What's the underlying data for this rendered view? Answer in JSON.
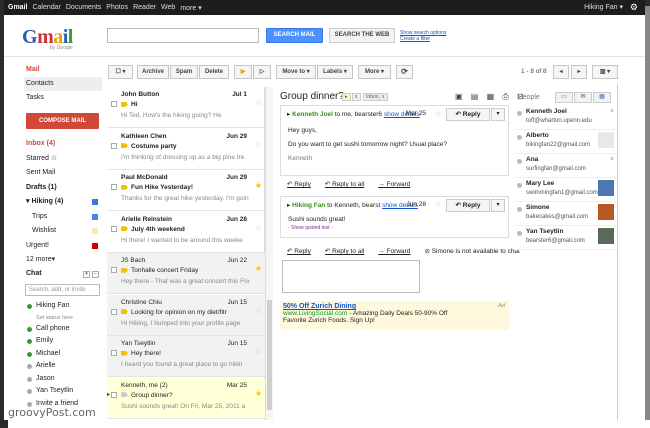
{
  "topbar": {
    "links": [
      "Gmail",
      "Calendar",
      "Documents",
      "Photos",
      "Reader",
      "Web",
      "more ▾"
    ],
    "user": "Hiking Fan ▾"
  },
  "logo": {
    "g": "G",
    "m": "m",
    "a": "a",
    "i": "i",
    "l": "l",
    "sub": "by Google"
  },
  "search": {
    "placeholder": "",
    "mail_button": "SEARCH MAIL",
    "web_button": "SEARCH THE WEB",
    "options_link": "Show search options",
    "filter_link": "Create a filter"
  },
  "nav": {
    "mail": "Mail",
    "contacts": "Contacts",
    "tasks": "Tasks",
    "compose": "COMPOSE MAIL",
    "folders": [
      {
        "label": "Inbox (4)",
        "style": "red"
      },
      {
        "label": "Starred ☆",
        "style": ""
      },
      {
        "label": "Sent Mail",
        "style": ""
      },
      {
        "label": "Drafts (1)",
        "style": "bold"
      },
      {
        "label": "▾ Hiking (4)",
        "style": "bold",
        "swatch": "#3c78d8"
      },
      {
        "label": "Trips",
        "style": "indent",
        "swatch": "#4a86e8"
      },
      {
        "label": "Wishlist",
        "style": "indent",
        "swatch": "#fce8b3"
      },
      {
        "label": "Urgent!",
        "style": "",
        "swatch": "#cc0000"
      },
      {
        "label": "12 more▾",
        "style": ""
      }
    ]
  },
  "chat": {
    "title": "Chat",
    "search_placeholder": "Search, add, or invite",
    "me": "Hiking Fan",
    "status": "Set status here",
    "contacts": [
      {
        "name": "Call phone",
        "color": "#3a9a3a"
      },
      {
        "name": "Emily",
        "color": "#3a9a3a"
      },
      {
        "name": "Michael",
        "color": "#3a9a3a"
      },
      {
        "name": "Arielle",
        "color": "#aaaaaa"
      },
      {
        "name": "Jason",
        "color": "#aaaaaa"
      },
      {
        "name": "Yan Tseytlin",
        "color": "#aaaaaa"
      },
      {
        "name": "Invite a friend",
        "color": "#aaaaaa"
      }
    ]
  },
  "toolbar": {
    "select": "☐ ▾",
    "archive": "Archive",
    "spam": "Spam",
    "delete": "Delete",
    "important": "▶",
    "not_important": "▷",
    "move": "Move to ▾",
    "labels": "Labels ▾",
    "more": "More ▾",
    "refresh": "⟳",
    "pager": "1 - 8 of 8",
    "prev": "◂",
    "next": "▸",
    "view": "▥ ▾"
  },
  "messages": [
    {
      "from": "John Button",
      "date": "Jul 1",
      "subject": "Hi",
      "snippet": "Hi Ted, How's the hiking going? He",
      "unread": true,
      "starred": false,
      "important": true
    },
    {
      "from": "Kathleen Chen",
      "date": "Jun 29",
      "subject": "Costume party",
      "snippet": "I'm thinking of dressing up as a big pine tre",
      "unread": true,
      "starred": false,
      "important": true
    },
    {
      "from": "Paul McDonald",
      "date": "Jun 29",
      "subject": "Fun Hike Yesterday!",
      "snippet": "Thanks for the great hike yesterday. I'm goin",
      "unread": true,
      "starred": true,
      "important": true
    },
    {
      "from": "Arielle Reinstein",
      "date": "Jun 28",
      "subject": "July 4th weekend",
      "snippet": "Hi there! I wanted to be around this weeke",
      "unread": true,
      "starred": false,
      "important": true
    },
    {
      "from": "JS Bach",
      "date": "Jun 22",
      "subject": "Tonhalle concert Friday",
      "snippet": "Hey there - That was a great concert this Frida",
      "unread": false,
      "starred": true,
      "important": true
    },
    {
      "from": "Christine Chiu",
      "date": "Jun 15",
      "subject": "Hi Hiking, I bumped into your profile page",
      "snippet": "",
      "unread": false,
      "starred": false,
      "important": true,
      "subject_prefix": "Looking for opinion on my diet/fitr"
    },
    {
      "from": "Yan Tseytlin",
      "date": "Jun 15",
      "subject": "Hey there!",
      "snippet": "I heard you found a great place to go hikin",
      "unread": false,
      "starred": false,
      "important": true
    },
    {
      "from": "Kenneth, me (2)",
      "date": "Mar 25",
      "subject": "Group dinner?",
      "snippet": "Sushi sounds great! On Fri, Mar 25, 2011 a",
      "unread": false,
      "starred": true,
      "important": false,
      "selected": true
    }
  ],
  "conversation": {
    "title": "Group dinner?",
    "tags": [
      "x",
      "Inbox",
      "x"
    ],
    "icons": "▣ ▤ ▦ ⎙ ⊡",
    "msg1": {
      "from": "Kenneth Joel",
      "to": "to me, bearster6",
      "details": "show details",
      "date": "Mar 25",
      "reply": "↶ Reply",
      "more": "▾",
      "body": [
        "Hey guys,",
        "",
        "Do you want to get sushi tomorrow night?  Usual place?",
        "",
        "Kenneth"
      ]
    },
    "actions1": [
      "↶ Reply",
      "↶ Reply to all",
      "→ Forward"
    ],
    "msg2": {
      "from": "Hiking Fan",
      "to": "to Kenneth, bearst",
      "details": "show details",
      "date": "Jun 28",
      "reply": "↶ Reply",
      "more": "▾",
      "body": "Sushi sounds great!",
      "quoted": "- Show quoted text -"
    },
    "actions2": [
      "↶ Reply",
      "↶ Reply to all",
      "→ Forward"
    ],
    "unavailable": "⊘ Simone is not available to chat"
  },
  "ad": {
    "title": "50% Off Zurich Dining",
    "url": "www.LivingSocial.com",
    "desc1": "- Amazing Daily Deals 50-90% Off",
    "desc2": "Favorite Zurich Foods. Sign Up!",
    "label": "Ad"
  },
  "people": {
    "title": "People",
    "list": [
      {
        "name": "Kenneth Joel",
        "email": "toff@wharton.upenn.edu",
        "status": "#bbbbbb",
        "pic": ""
      },
      {
        "name": "Alberto",
        "email": "bikingfan22@gmail.com",
        "status": "#bbbbbb",
        "pic": "#e8e8e8"
      },
      {
        "name": "Ana",
        "email": "surfingfan@gmail.com",
        "status": "#bbbbbb",
        "pic": ""
      },
      {
        "name": "Mary Lee",
        "email": "swimmingfan1@gmail.com",
        "status": "#bbbbbb",
        "pic": "#4a7ab0"
      },
      {
        "name": "Simone",
        "email": "bakecakes@gmail.com",
        "status": "#bbbbbb",
        "pic": "#b85a20"
      },
      {
        "name": "Yan Tseytlin",
        "email": "bearster6@gmail.com",
        "status": "#bbbbbb",
        "pic": "#5a6a5a"
      }
    ]
  },
  "watermark": "groovyPost.com"
}
